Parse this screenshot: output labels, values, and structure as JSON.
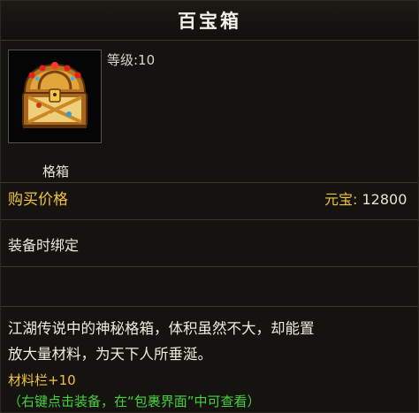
{
  "item": {
    "title": "百宝箱",
    "level": "等级:10",
    "type": "格箱",
    "icon": "treasure-chest-icon"
  },
  "price": {
    "label": "购买价格",
    "currency": "元宝:",
    "amount": "12800"
  },
  "bind_text": "装备时绑定",
  "description": {
    "line1": "江湖传说中的神秘格箱，体积虽然不大，却能置",
    "line2": "放大量材料，为天下人所垂涎。"
  },
  "bonus": "材料栏+10",
  "hint": "（右键点击装备，在“包裹界面”中可查看）",
  "colors": {
    "gold": "#f1c33a",
    "green": "#46d13a",
    "background": "#14130f"
  }
}
